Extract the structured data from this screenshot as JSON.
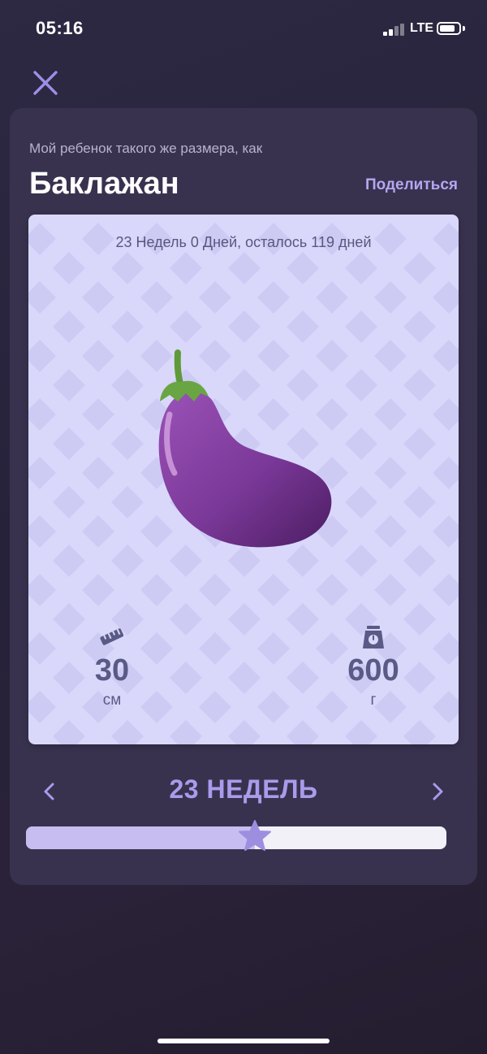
{
  "status_bar": {
    "time": "05:16",
    "network": "LTE",
    "battery_level": 0.85,
    "signal_bars_filled": 2,
    "signal_bars_total": 4
  },
  "icons": {
    "close": "close-icon",
    "ruler": "ruler-icon",
    "scale": "scale-icon",
    "prev": "chevron-left-icon",
    "next": "chevron-right-icon",
    "star": "star-icon"
  },
  "card": {
    "subtitle": "Мой ребенок такого же размера, как",
    "title": "Баклажан",
    "share_label": "Поделиться",
    "week_status": "23 Недель 0 Дней, осталось 119 дней",
    "length": {
      "value": "30",
      "unit": "см"
    },
    "weight": {
      "value": "600",
      "unit": "г"
    }
  },
  "week_nav": {
    "label": "23 НЕДЕЛЬ",
    "progress": 0.545
  },
  "colors": {
    "accent": "#aa9bec",
    "card_bg": "#39324f",
    "panel_bg": "#d9d8fb",
    "stat_text": "#595a86",
    "eggplant": "#7b3a98",
    "stem": "#5f9a3a"
  }
}
